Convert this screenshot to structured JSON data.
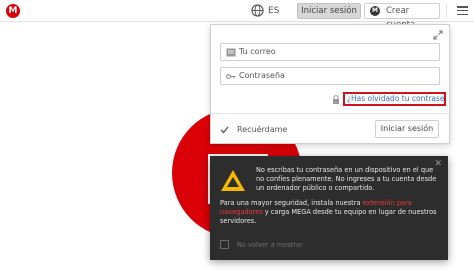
{
  "topbar": {
    "logo_letter": "M",
    "language": "ES",
    "login_label": "Iniciar sesión",
    "create_account_label": "Crear cuenta",
    "create_logo_letter": "M"
  },
  "login_panel": {
    "email_placeholder": "Tu correo",
    "password_placeholder": "Contraseña",
    "forgot_password": "¿Has olvidado tu contraseña?",
    "remember_me": "Recuérdame",
    "login_button": "Iniciar sesión"
  },
  "warning": {
    "close_symbol": "✕",
    "message_1": "No escribas tu contraseña en un dispositivo en el que no confíes plenamente. No ingreses a tu cuenta desde un ordenador público o compartido.",
    "message_2_before": "Para una mayor seguridad, instala nuestra ",
    "message_2_link": "extensión para navegadores",
    "message_2_after": " y carga MEGA desde tu equipo en lugar de nuestros servidores.",
    "no_show_again": "No volver a mostrar"
  },
  "colors": {
    "brand_red": "#d90007",
    "highlight_border": "#d0111b",
    "link_blue": "#3b6fb5",
    "warning_bg": "#2d2d2d",
    "warning_icon": "#f5b800"
  },
  "icons": [
    "mega-logo-icon",
    "globe-icon",
    "hamburger-menu-icon",
    "expand-icon",
    "email-icon",
    "key-icon",
    "lock-icon",
    "check-icon",
    "warning-triangle-icon",
    "close-icon"
  ]
}
